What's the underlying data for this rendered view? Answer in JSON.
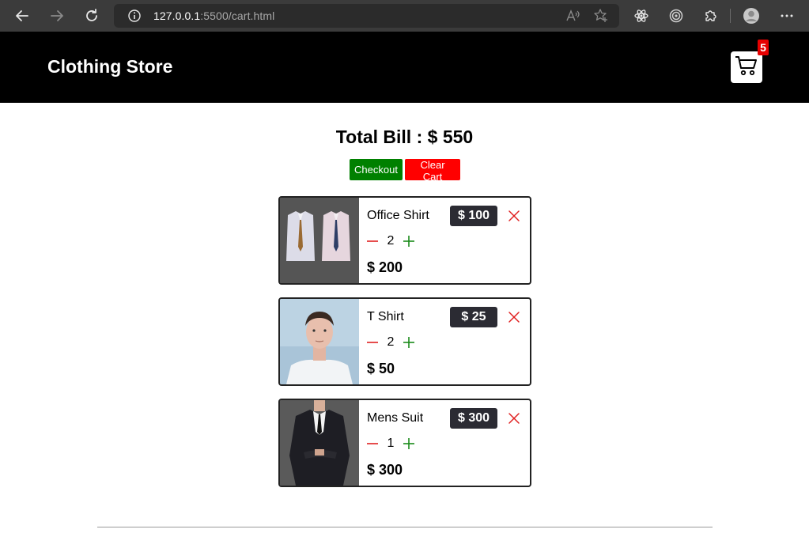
{
  "browser": {
    "url_host": "127.0.0.1",
    "url_rest": ":5500/cart.html"
  },
  "header": {
    "title": "Clothing Store",
    "cart_count": "5"
  },
  "summary": {
    "total_label": "Total Bill : $ 550",
    "checkout_label": "Checkout",
    "clear_label": "Clear Cart"
  },
  "cart": {
    "items": [
      {
        "name": "Office Shirt",
        "price": "$ 100",
        "qty": "2",
        "subtotal": "$ 200"
      },
      {
        "name": "T Shirt",
        "price": "$ 25",
        "qty": "2",
        "subtotal": "$ 50"
      },
      {
        "name": "Mens Suit",
        "price": "$ 300",
        "qty": "1",
        "subtotal": "$ 300"
      }
    ]
  },
  "colors": {
    "checkout": "#008000",
    "clear": "#ff0000",
    "badge": "#e60000",
    "header_bg": "#000000",
    "price_tag": "#2b2b33"
  },
  "icons": [
    "back-icon",
    "forward-icon",
    "reload-icon",
    "info-icon",
    "read-aloud-icon",
    "favorite-icon",
    "react-devtools-icon",
    "circle-target-icon",
    "extensions-icon",
    "profile-icon",
    "more-icon",
    "cart-icon",
    "close-icon",
    "minus-icon",
    "plus-icon"
  ]
}
